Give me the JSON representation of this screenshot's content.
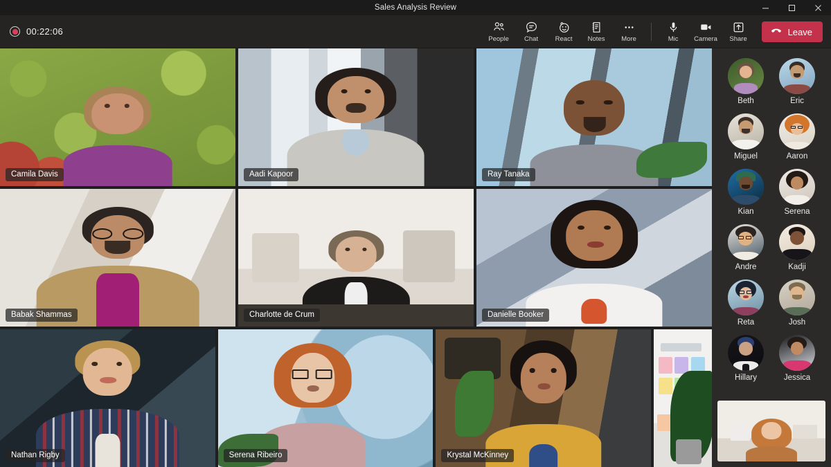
{
  "window": {
    "title": "Sales Analysis Review",
    "controls": [
      {
        "name": "minimize",
        "glyph": "minimize-icon"
      },
      {
        "name": "maximize",
        "glyph": "maximize-icon"
      },
      {
        "name": "close",
        "glyph": "close-icon"
      }
    ]
  },
  "toolbar": {
    "recording_indicator": "recording-icon",
    "timer": "00:22:06",
    "tools": [
      {
        "id": "people",
        "label": "People",
        "icon": "people-icon"
      },
      {
        "id": "chat",
        "label": "Chat",
        "icon": "chat-icon"
      },
      {
        "id": "react",
        "label": "React",
        "icon": "react-icon"
      },
      {
        "id": "notes",
        "label": "Notes",
        "icon": "notes-icon"
      },
      {
        "id": "more",
        "label": "More",
        "icon": "more-icon"
      }
    ],
    "media": [
      {
        "id": "mic",
        "label": "Mic",
        "icon": "microphone-icon"
      },
      {
        "id": "camera",
        "label": "Camera",
        "icon": "camera-icon"
      },
      {
        "id": "share",
        "label": "Share",
        "icon": "share-icon"
      }
    ],
    "leave_label": "Leave",
    "leave_icon": "hangup-icon",
    "leave_color": "#c4314b"
  },
  "stage": {
    "rows": [
      [
        {
          "name": "Camila Davis",
          "scene": "sc-camila",
          "kind": "avatar"
        },
        {
          "name": "Aadi Kapoor",
          "scene": "sc-aadi",
          "kind": "video"
        },
        {
          "name": "Ray Tanaka",
          "scene": "sc-ray",
          "kind": "avatar"
        }
      ],
      [
        {
          "name": "Babak Shammas",
          "scene": "sc-babak",
          "kind": "video"
        },
        {
          "name": "Charlotte de Crum",
          "scene": "sc-charlotte",
          "kind": "video"
        },
        {
          "name": "Danielle Booker",
          "scene": "sc-danielle",
          "kind": "video"
        }
      ],
      [
        {
          "name": "Nathan Rigby",
          "scene": "sc-nathan",
          "kind": "video"
        },
        {
          "name": "Serena Ribeiro",
          "scene": "sc-serenar",
          "kind": "avatar"
        },
        {
          "name": "Krystal McKinney",
          "scene": "sc-krystal",
          "kind": "avatar"
        }
      ]
    ],
    "side_panel": {
      "name": "shared-whiteboard",
      "scene": "sc-board"
    }
  },
  "roster": {
    "people": [
      {
        "name": "Beth",
        "kind": "video"
      },
      {
        "name": "Eric",
        "kind": "avatar"
      },
      {
        "name": "Miguel",
        "kind": "video"
      },
      {
        "name": "Aaron",
        "kind": "video"
      },
      {
        "name": "Kian",
        "kind": "avatar"
      },
      {
        "name": "Serena",
        "kind": "video"
      },
      {
        "name": "Andre",
        "kind": "video"
      },
      {
        "name": "Kadji",
        "kind": "video"
      },
      {
        "name": "Reta",
        "kind": "avatar"
      },
      {
        "name": "Josh",
        "kind": "video"
      },
      {
        "name": "Hillary",
        "kind": "avatar"
      },
      {
        "name": "Jessica",
        "kind": "video"
      }
    ],
    "self_view": {
      "name": "self-view",
      "scene": "sc-self"
    }
  }
}
